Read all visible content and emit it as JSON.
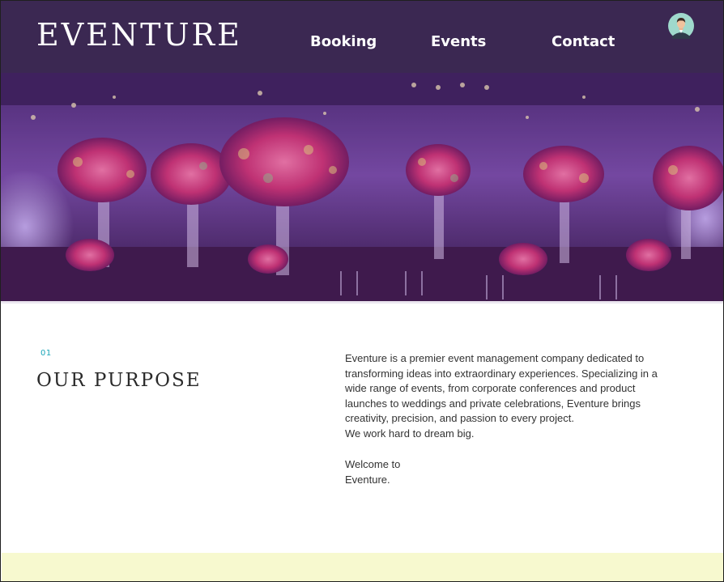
{
  "header": {
    "logo": "EVENTURE",
    "nav": {
      "booking": "Booking",
      "events": "Events",
      "contact": "Contact"
    },
    "avatar_icon": "user-avatar-icon"
  },
  "hero": {
    "image": "banquet-hall-floral-centerpieces-photo"
  },
  "purpose": {
    "number": "01",
    "title": "OUR PURPOSE",
    "paragraph": "Eventure is a premier event management company dedicated to transforming ideas into extraordinary experiences. Specializing in a wide range of events, from corporate conferences and product launches to weddings and private celebrations, Eventure brings creativity, precision, and passion to every project.",
    "tagline": "We work hard to dream big.",
    "welcome_line1": "Welcome to",
    "welcome_line2": "Eventure."
  },
  "colors": {
    "header_bg": "#3b2852",
    "accent_teal": "#1aa5b8",
    "footer_band": "#f7f9cf"
  }
}
